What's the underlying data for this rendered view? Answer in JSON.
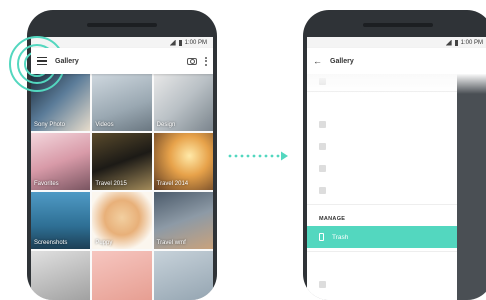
{
  "status": {
    "time": "1:00 PM"
  },
  "left_screen": {
    "title": "Gallery",
    "tiles": [
      {
        "caption": "Sony Photo",
        "bg": "linear-gradient(135deg,#1c2b3a,#5b7c99 45%,#e7dccb)"
      },
      {
        "caption": "Videos",
        "bg": "linear-gradient(160deg,#cfd8df,#9aa8b2 60%,#6a7781)"
      },
      {
        "caption": "Design",
        "bg": "linear-gradient(135deg,#e8e8e8,#b9c0c5 50%,#7b858d)"
      },
      {
        "caption": "Favorites",
        "bg": "linear-gradient(160deg,#f3d6dc,#d89aa8 50%,#7a5561)"
      },
      {
        "caption": "Travel 2015",
        "bg": "linear-gradient(160deg,#5a4b2c,#1c1a16 50%,#a38b5a)"
      },
      {
        "caption": "Travel 2014",
        "bg": "radial-gradient(circle at 60% 40%,#ffe9a8,#e7a24a 40%,#5e3b22)"
      },
      {
        "caption": "Screenshots",
        "bg": "linear-gradient(180deg,#4f9ac5,#2e6f94 60%,#1d3f55)"
      },
      {
        "caption": "Puppy",
        "bg": "radial-gradient(circle at 50% 45%,#f2cfa0,#e8b079 40%,#fbf6ee 75%)"
      },
      {
        "caption": "Travel wmf",
        "bg": "linear-gradient(160deg,#4b5a6a,#8d9aa6 50%,#c9a27c)"
      },
      {
        "caption": "",
        "bg": "linear-gradient(160deg,#e0e0e0,#9a9a9a)"
      },
      {
        "caption": "",
        "bg": "linear-gradient(160deg,#f6c6c0,#e59a8d)"
      },
      {
        "caption": "",
        "bg": "linear-gradient(160deg,#c7d2da,#8fa0ad)"
      }
    ]
  },
  "right_screen": {
    "title": "Gallery",
    "manage_label": "MANAGE",
    "selected_item": "Trash"
  },
  "colors": {
    "accent": "#53d7bf",
    "phone_body": "#2f3337"
  },
  "icons": [
    "menu-icon",
    "camera-icon",
    "more-vert-icon",
    "back-arrow-icon",
    "trash-icon",
    "signal-icon",
    "battery-icon"
  ]
}
